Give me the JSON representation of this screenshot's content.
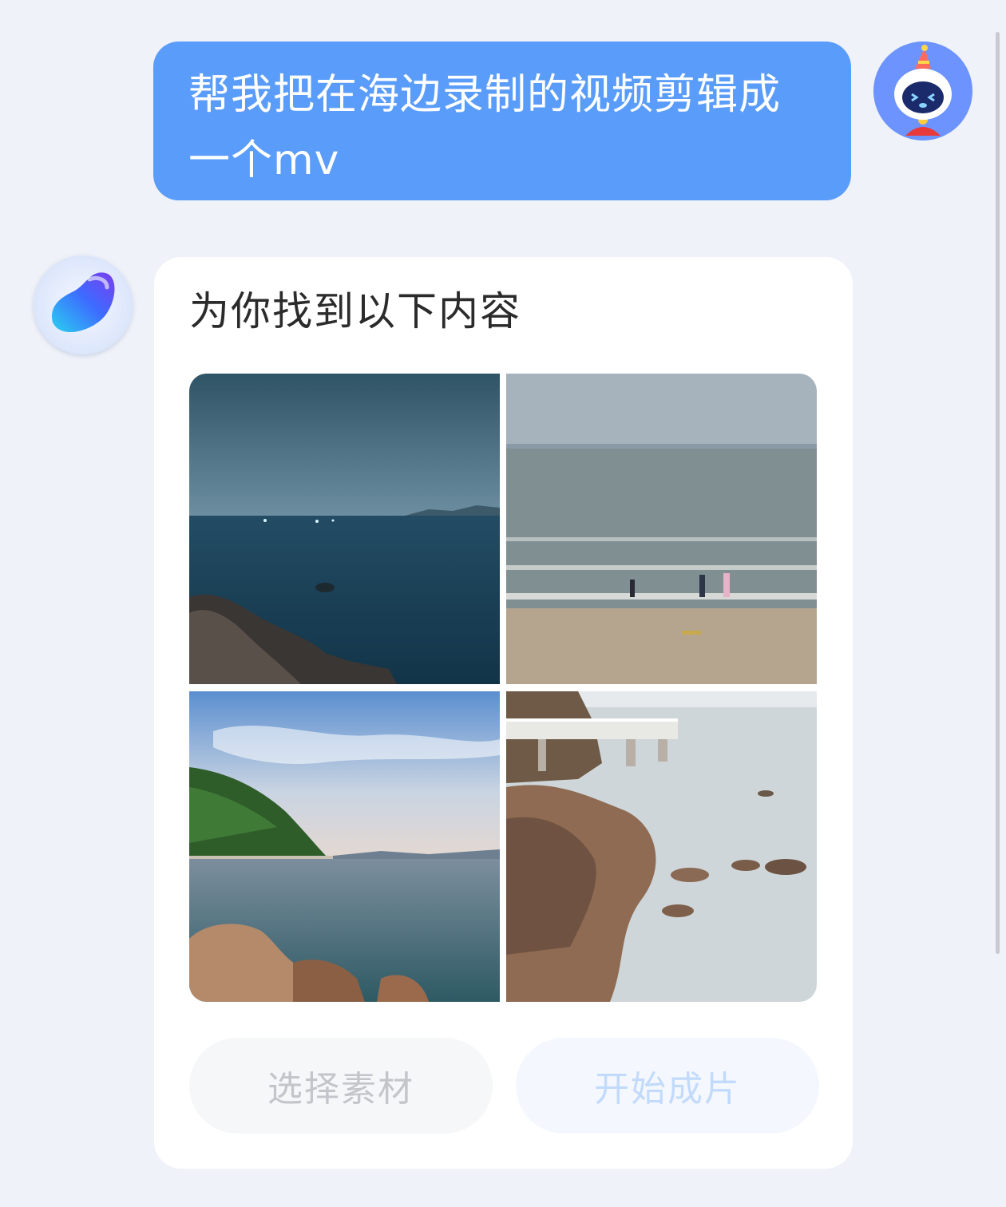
{
  "user_message": {
    "line1": "帮我把在海边录制的视频剪辑成",
    "line2": "一个mv"
  },
  "user_avatar": {
    "icon": "robot-mascot-party-hat-icon"
  },
  "bot_avatar": {
    "icon": "assistant-blob-logo-icon"
  },
  "bot_card": {
    "title": "为你找到以下内容",
    "images": [
      {
        "name": "seaside-dusk-rocks-image"
      },
      {
        "name": "beach-people-waves-image"
      },
      {
        "name": "green-hill-coast-rocks-image"
      },
      {
        "name": "boardwalk-rocky-shore-image"
      }
    ],
    "select_button": "选择素材",
    "start_button": "开始成片"
  },
  "colors": {
    "background": "#eff2f8",
    "user_bubble": "#5a9cfa",
    "card": "#ffffff",
    "select_button_bg": "#f6f7f9",
    "start_button_text": "#c2dafb"
  }
}
